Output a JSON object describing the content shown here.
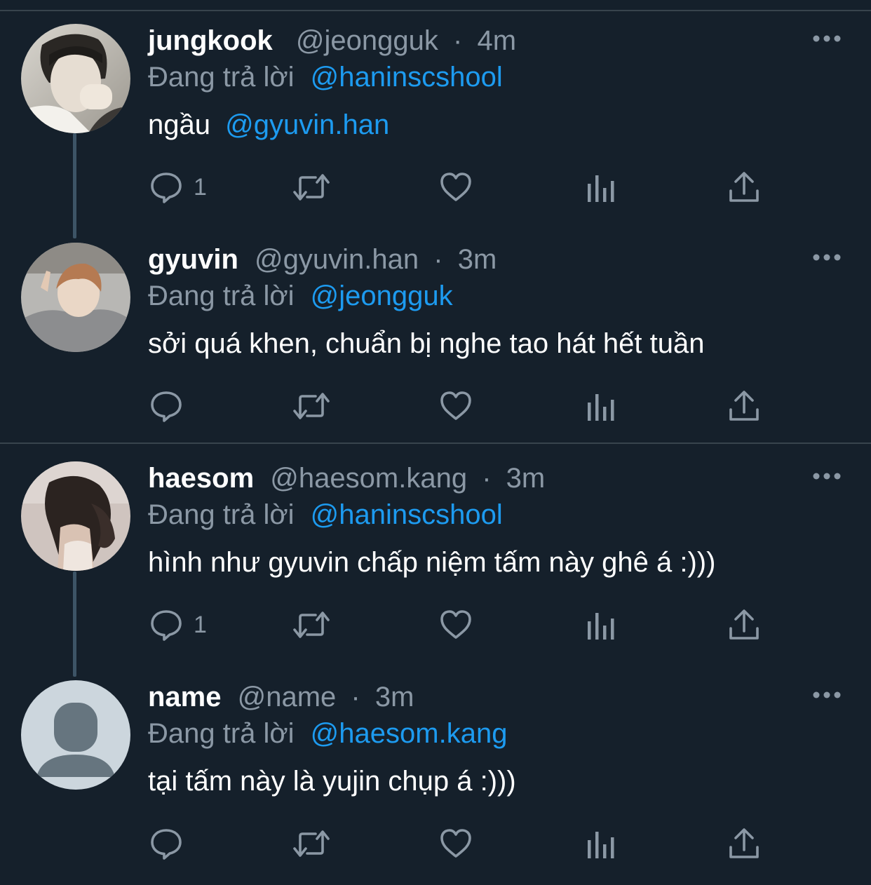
{
  "tweets": [
    {
      "display_name": "jungkook",
      "handle": "@jeongguk",
      "separator": "·",
      "time": "4m",
      "reply_prefix": "Đang trả lời",
      "reply_to": "@haninscshool",
      "text": "ngầu",
      "text_mention": "@gyuvin.han",
      "reply_count": "1",
      "avatar": "photo"
    },
    {
      "display_name": "gyuvin",
      "handle": "@gyuvin.han",
      "separator": "·",
      "time": "3m",
      "reply_prefix": "Đang trả lời",
      "reply_to": "@jeongguk",
      "text": "sởi quá khen, chuẩn bị nghe tao hát hết tuần",
      "text_mention": "",
      "reply_count": "",
      "avatar": "photo"
    },
    {
      "display_name": "haesom",
      "handle": "@haesom.kang",
      "separator": "·",
      "time": "3m",
      "reply_prefix": "Đang trả lời",
      "reply_to": "@haninscshool",
      "text": "hình như gyuvin chấp niệm tấm này ghê á :)))",
      "text_mention": "",
      "reply_count": "1",
      "avatar": "photo"
    },
    {
      "display_name": "name",
      "handle": "@name",
      "separator": "·",
      "time": "3m",
      "reply_prefix": "Đang trả lời",
      "reply_to": "@haesom.kang",
      "text": "tại tấm này là yujin chụp á :)))",
      "text_mention": "",
      "reply_count": "",
      "avatar": "default-profile-icon"
    }
  ],
  "icons": {
    "more": "more-options-icon",
    "reply": "reply-bubble-icon",
    "retweet": "retweet-icon",
    "like": "heart-icon",
    "views": "analytics-bars-icon",
    "share": "share-upload-icon"
  },
  "colors": {
    "background": "#15202b",
    "divider": "#38444d",
    "thread_line": "#3d5466",
    "secondary_text": "#8b98a5",
    "mention": "#1d9bf0",
    "primary_text": "#ffffff"
  }
}
